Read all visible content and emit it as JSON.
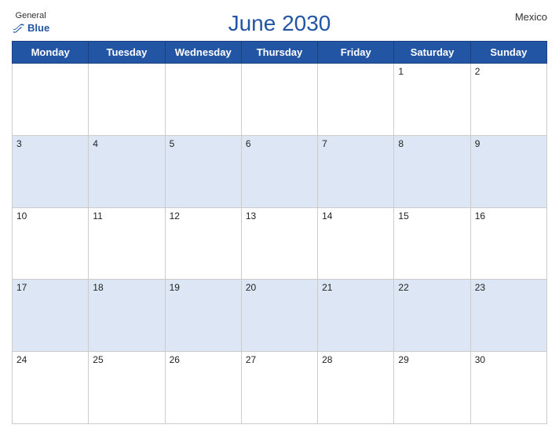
{
  "header": {
    "logo_general": "General",
    "logo_blue": "Blue",
    "title": "June 2030",
    "country": "Mexico"
  },
  "calendar": {
    "weekdays": [
      "Monday",
      "Tuesday",
      "Wednesday",
      "Thursday",
      "Friday",
      "Saturday",
      "Sunday"
    ],
    "rows": [
      [
        {
          "day": "",
          "shade": "white"
        },
        {
          "day": "",
          "shade": "white"
        },
        {
          "day": "",
          "shade": "white"
        },
        {
          "day": "",
          "shade": "white"
        },
        {
          "day": "",
          "shade": "white"
        },
        {
          "day": "1",
          "shade": "white"
        },
        {
          "day": "2",
          "shade": "white"
        }
      ],
      [
        {
          "day": "3",
          "shade": "blue"
        },
        {
          "day": "4",
          "shade": "blue"
        },
        {
          "day": "5",
          "shade": "blue"
        },
        {
          "day": "6",
          "shade": "blue"
        },
        {
          "day": "7",
          "shade": "blue"
        },
        {
          "day": "8",
          "shade": "blue"
        },
        {
          "day": "9",
          "shade": "blue"
        }
      ],
      [
        {
          "day": "10",
          "shade": "white"
        },
        {
          "day": "11",
          "shade": "white"
        },
        {
          "day": "12",
          "shade": "white"
        },
        {
          "day": "13",
          "shade": "white"
        },
        {
          "day": "14",
          "shade": "white"
        },
        {
          "day": "15",
          "shade": "white"
        },
        {
          "day": "16",
          "shade": "white"
        }
      ],
      [
        {
          "day": "17",
          "shade": "blue"
        },
        {
          "day": "18",
          "shade": "blue"
        },
        {
          "day": "19",
          "shade": "blue"
        },
        {
          "day": "20",
          "shade": "blue"
        },
        {
          "day": "21",
          "shade": "blue"
        },
        {
          "day": "22",
          "shade": "blue"
        },
        {
          "day": "23",
          "shade": "blue"
        }
      ],
      [
        {
          "day": "24",
          "shade": "white"
        },
        {
          "day": "25",
          "shade": "white"
        },
        {
          "day": "26",
          "shade": "white"
        },
        {
          "day": "27",
          "shade": "white"
        },
        {
          "day": "28",
          "shade": "white"
        },
        {
          "day": "29",
          "shade": "white"
        },
        {
          "day": "30",
          "shade": "white"
        }
      ]
    ]
  }
}
